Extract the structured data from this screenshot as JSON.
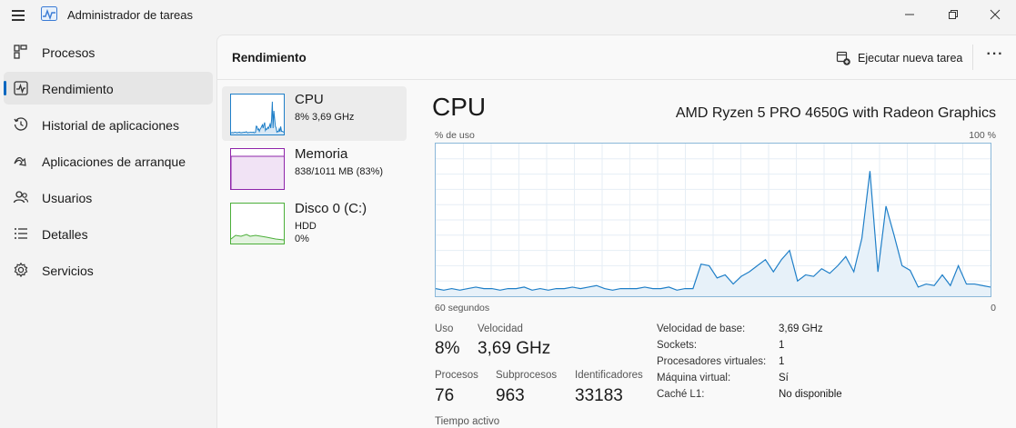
{
  "window": {
    "title": "Administrador de tareas"
  },
  "sidebar": {
    "items": [
      {
        "label": "Procesos",
        "icon": "processes-icon"
      },
      {
        "label": "Rendimiento",
        "icon": "performance-icon",
        "active": true
      },
      {
        "label": "Historial de aplicaciones",
        "icon": "history-icon"
      },
      {
        "label": "Aplicaciones de arranque",
        "icon": "startup-icon"
      },
      {
        "label": "Usuarios",
        "icon": "users-icon"
      },
      {
        "label": "Detalles",
        "icon": "details-icon"
      },
      {
        "label": "Servicios",
        "icon": "services-icon"
      }
    ]
  },
  "header": {
    "title": "Rendimiento",
    "run_task_label": "Ejecutar nueva tarea",
    "more_label": "···"
  },
  "devices": [
    {
      "name": "CPU",
      "line1": "8%  3,69 GHz",
      "line2": "",
      "color": "#1f7fc8"
    },
    {
      "name": "Memoria",
      "line1": "838/1011 MB (83%)",
      "line2": "",
      "color": "#8e24aa"
    },
    {
      "name": "Disco 0 (C:)",
      "line1": "HDD",
      "line2": "0%",
      "color": "#4caf3a"
    }
  ],
  "detail": {
    "title": "CPU",
    "model": "AMD Ryzen 5 PRO 4650G with Radeon Graphics",
    "y_axis_label": "% de uso",
    "y_axis_max": "100 %",
    "x_axis_left": "60 segundos",
    "x_axis_right": "0",
    "stats": {
      "uso_label": "Uso",
      "uso_value": "8%",
      "velocidad_label": "Velocidad",
      "velocidad_value": "3,69 GHz",
      "procesos_label": "Procesos",
      "procesos_value": "76",
      "subprocesos_label": "Subprocesos",
      "subprocesos_value": "963",
      "identificadores_label": "Identificadores",
      "identificadores_value": "33183",
      "tiempo_label": "Tiempo activo"
    },
    "info": [
      {
        "key": "Velocidad de base:",
        "value": "3,69 GHz"
      },
      {
        "key": "Sockets:",
        "value": "1"
      },
      {
        "key": "Procesadores virtuales:",
        "value": "1"
      },
      {
        "key": "Máquina virtual:",
        "value": "Sí"
      },
      {
        "key": "Caché L1:",
        "value": "No disponible"
      }
    ]
  },
  "chart_data": {
    "type": "area",
    "x": [
      60,
      59,
      58,
      57,
      56,
      55,
      54,
      53,
      52,
      51,
      50,
      49,
      48,
      47,
      46,
      45,
      44,
      43,
      42,
      41,
      40,
      39,
      38,
      37,
      36,
      35,
      34,
      33,
      32,
      31,
      30,
      29,
      28,
      27,
      26,
      25,
      24,
      23,
      22,
      21,
      20,
      19,
      18,
      17,
      16,
      15,
      14,
      13,
      12,
      11,
      10,
      9,
      8,
      7,
      6,
      5,
      4,
      3,
      2,
      1,
      0
    ],
    "series": [
      {
        "values": [
          5,
          4,
          5,
          4,
          5,
          6,
          5,
          5,
          4,
          5,
          5,
          6,
          4,
          5,
          4,
          5,
          5,
          6,
          5,
          6,
          7,
          5,
          4,
          5,
          5,
          5,
          6,
          5,
          5,
          6,
          4,
          5,
          5,
          21,
          20,
          12,
          14,
          8,
          13,
          16,
          20,
          24,
          16,
          24,
          30,
          10,
          14,
          13,
          18,
          15,
          20,
          26,
          16,
          38,
          82,
          16,
          59,
          40,
          20,
          17,
          6,
          8,
          7,
          14,
          7,
          20,
          8,
          8,
          7,
          6
        ],
        "color": "#1f7fc8"
      }
    ],
    "xlim": [
      60,
      0
    ],
    "ylim": [
      0,
      100
    ],
    "grid": true
  }
}
